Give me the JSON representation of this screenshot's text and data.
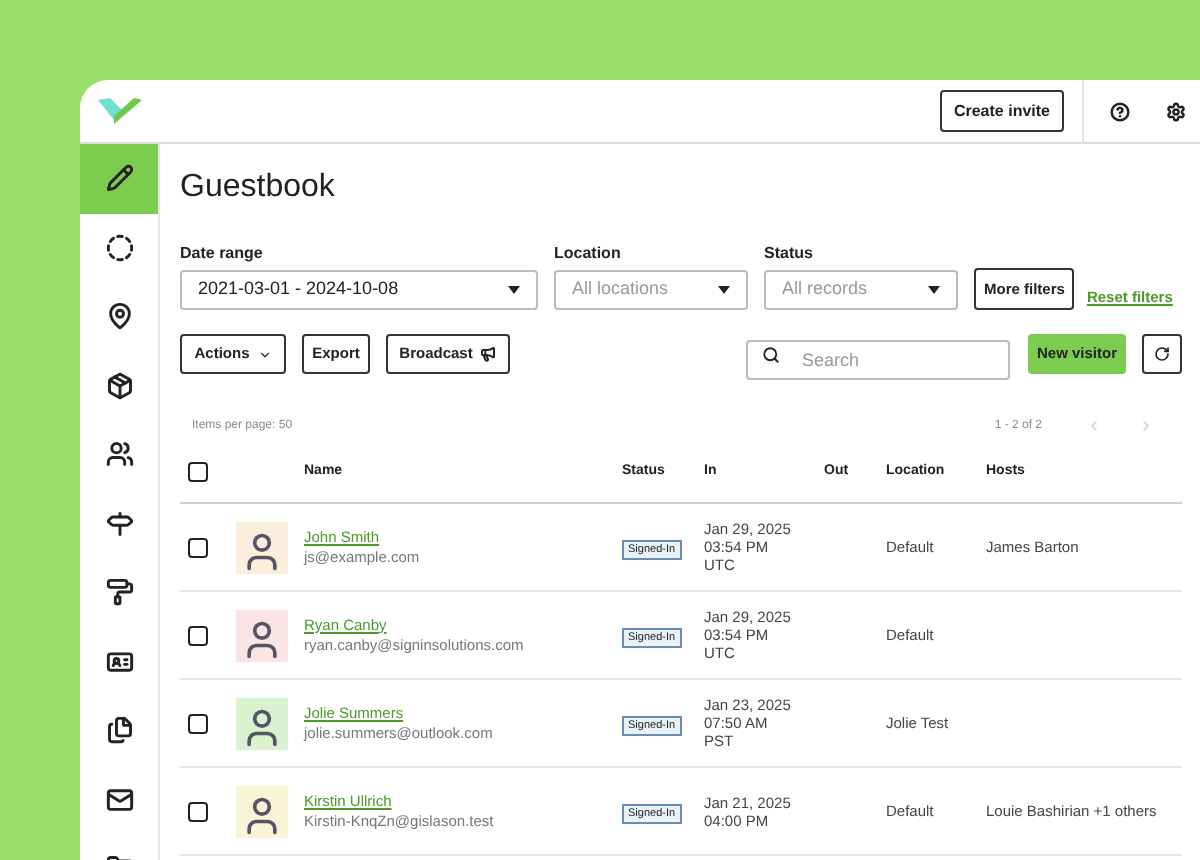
{
  "topbar": {
    "create_invite": "Create invite"
  },
  "sidebar": {
    "items": [
      {
        "selected": true
      },
      {
        "selected": false
      },
      {
        "selected": false
      },
      {
        "selected": false
      },
      {
        "selected": false
      },
      {
        "selected": false
      },
      {
        "selected": false
      },
      {
        "selected": false
      },
      {
        "selected": false
      },
      {
        "selected": false
      },
      {
        "selected": false
      }
    ]
  },
  "title": "Guestbook",
  "filters": [
    {
      "label": "Date range",
      "value": "2021-03-01 - 2024-10-08"
    },
    {
      "label": "Location",
      "placeholder": "All locations"
    },
    {
      "label": "Status",
      "placeholder": "All records"
    }
  ],
  "more_filters": "More filters",
  "reset_filters": "Reset filters",
  "toolbar": {
    "actions": "Actions",
    "export": "Export",
    "broadcast": "Broadcast",
    "search_placeholder": "Search",
    "new_visitor": "New visitor"
  },
  "pagination": {
    "items_per_page": "Items per page: 50",
    "range": "1 - 2 of 2",
    "prev_disabled": true,
    "next_disabled": true
  },
  "table": {
    "header_checked": false,
    "columns": [
      "Name",
      "Status",
      "In",
      "Out",
      "Location",
      "Hosts"
    ],
    "rows": [
      {
        "checked": false,
        "name": "John Smith",
        "email": "js@example.com",
        "status": "Signed-In",
        "in": [
          "Jan 29, 2025",
          "03:54 PM",
          "UTC"
        ],
        "location": "Default",
        "hosts": "James Barton"
      },
      {
        "checked": false,
        "name": "Ryan Canby",
        "email": "ryan.canby@signinsolutions.com",
        "status": "Signed-In",
        "in": [
          "Jan 29, 2025",
          "03:54 PM",
          "UTC"
        ],
        "location": "Default"
      },
      {
        "checked": false,
        "name": "Jolie Summers",
        "email": "jolie.summers@outlook.com",
        "status": "Signed-In",
        "in": [
          "Jan 23, 2025",
          "07:50 AM",
          "PST"
        ],
        "location": "Jolie Test"
      },
      {
        "checked": false,
        "name": "Kirstin Ullrich",
        "email": "Kirstin-KnqZn@gislason.test",
        "status": "Signed-In",
        "in": [
          "Jan 21, 2025",
          "04:00 PM"
        ],
        "location": "Default",
        "hosts": "Louie Bashirian +1 others"
      }
    ]
  }
}
